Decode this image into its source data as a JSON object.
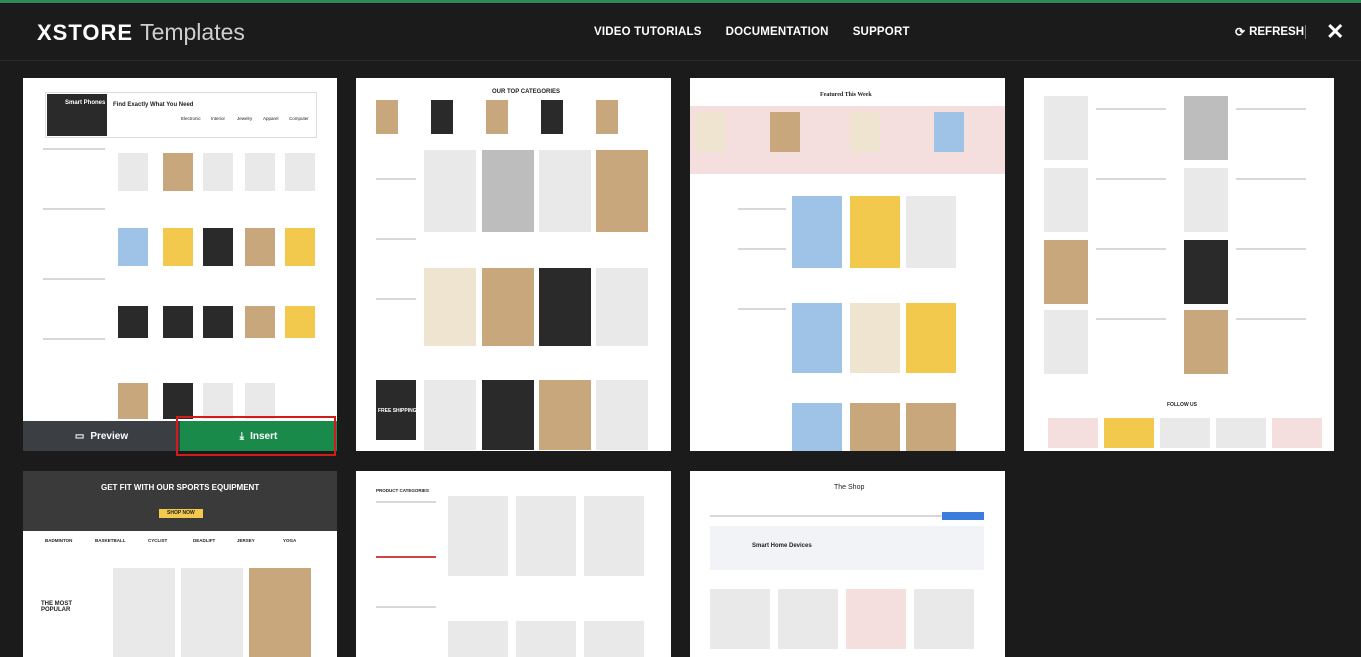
{
  "header": {
    "logo_brand": "XSTORE",
    "logo_sub": "Templates",
    "nav": [
      "VIDEO TUTORIALS",
      "DOCUMENTATION",
      "SUPPORT"
    ],
    "refresh_label": "REFRESH",
    "close_label": "✕"
  },
  "cards": {
    "card1": {
      "hero_title": "Smart Phones",
      "hero_tagline": "Find Exactly What You Need",
      "categories": [
        "Electronic",
        "Interior",
        "Jewelry",
        "Apparel",
        "Computer"
      ],
      "preview_label": "Preview",
      "insert_label": "Insert"
    },
    "card2": {
      "heading": "OUR TOP CATEGORIES",
      "banner": "FREE SHIPPING"
    },
    "card3": {
      "heading": "Featured This Week"
    },
    "card4": {
      "footer": "FOLLOW US"
    },
    "card5": {
      "hero": "GET FIT WITH OUR SPORTS EQUIPMENT",
      "cta": "SHOP NOW",
      "popular": "THE MOST POPULAR",
      "categories": [
        "BADMINTON",
        "BASKETBALL",
        "CYCLIST",
        "DEADLIFT",
        "JERSEY",
        "YOGA"
      ]
    },
    "card6": {
      "sidebar_title": "PRODUCT CATEGORIES"
    },
    "card7": {
      "heading": "The Shop",
      "banner": "Smart Home Devices"
    }
  }
}
